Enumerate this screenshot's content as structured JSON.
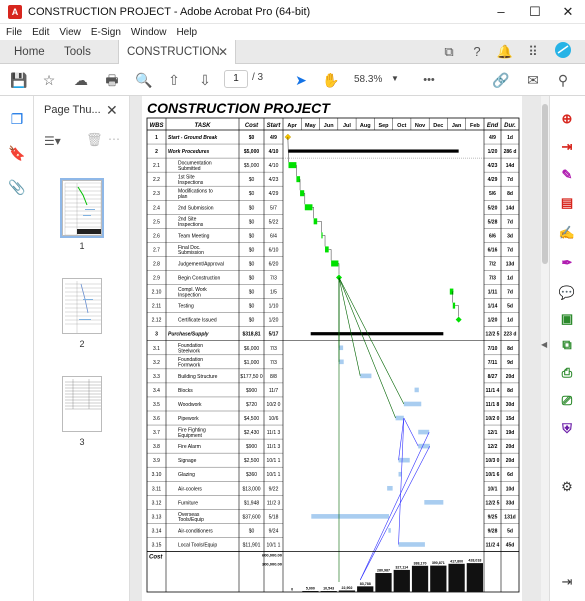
{
  "window": {
    "title": "CONSTRUCTION PROJECT - Adobe Acrobat Pro (64-bit)",
    "minimize": "–",
    "maximize": "☐",
    "close": "✕"
  },
  "menu": [
    "File",
    "Edit",
    "View",
    "E-Sign",
    "Window",
    "Help"
  ],
  "tabs": {
    "home": "Home",
    "tools": "Tools",
    "document": "CONSTRUCTION P...",
    "close": "✕"
  },
  "toolbar": {
    "current_page": "1",
    "page_total": "/ 3",
    "zoom": "58.3%",
    "more": "•••"
  },
  "thumbnails": {
    "title": "Page Thu...",
    "pages": [
      "1",
      "2",
      "3"
    ]
  },
  "document": {
    "title": "CONSTRUCTION PROJECT",
    "columns": [
      "WBS",
      "TASK",
      "Cost",
      "Start"
    ],
    "right_columns": [
      "End",
      "Dur."
    ],
    "months": [
      "Apr",
      "May",
      "Jun",
      "Jul",
      "Aug",
      "Sep",
      "Oct",
      "Nov",
      "Dec",
      "Jan",
      "Feb"
    ],
    "rows": [
      {
        "wbs": "1",
        "task": "Start - Ground Break",
        "cost": "$0",
        "start": "4/9",
        "end": "4/9",
        "dur": "1d",
        "bold": true
      },
      {
        "wbs": "2",
        "task": "Work Procedures",
        "cost": "$5,000",
        "start": "4/10",
        "end": "1/20",
        "dur": "286 d",
        "bold": true
      },
      {
        "wbs": "2.1",
        "task": "Documentation Submitted",
        "cost": "$5,000",
        "start": "4/10",
        "end": "4/23",
        "dur": "14d"
      },
      {
        "wbs": "2.2",
        "task": "1st Site Inspections",
        "cost": "$0",
        "start": "4/23",
        "end": "4/29",
        "dur": "7d"
      },
      {
        "wbs": "2.3",
        "task": "Modifications to plan",
        "cost": "$0",
        "start": "4/29",
        "end": "5/6",
        "dur": "8d"
      },
      {
        "wbs": "2.4",
        "task": "2nd Submission",
        "cost": "$0",
        "start": "5/7",
        "end": "5/20",
        "dur": "14d"
      },
      {
        "wbs": "2.5",
        "task": "2nd Site Inspections",
        "cost": "$0",
        "start": "5/22",
        "end": "5/28",
        "dur": "7d"
      },
      {
        "wbs": "2.6",
        "task": "Team Meeting",
        "cost": "$0",
        "start": "6/4",
        "end": "6/6",
        "dur": "3d"
      },
      {
        "wbs": "2.7",
        "task": "Final Doc. Submission",
        "cost": "$0",
        "start": "6/10",
        "end": "6/16",
        "dur": "7d"
      },
      {
        "wbs": "2.8",
        "task": "Judgement/Approval",
        "cost": "$0",
        "start": "6/20",
        "end": "7/2",
        "dur": "13d"
      },
      {
        "wbs": "2.9",
        "task": "Begin Construction",
        "cost": "$0",
        "start": "7/3",
        "end": "7/3",
        "dur": "1d"
      },
      {
        "wbs": "2.10",
        "task": "Compl. Work Inspection",
        "cost": "$0",
        "start": "1/5",
        "end": "1/11",
        "dur": "7d"
      },
      {
        "wbs": "2.11",
        "task": "Testing",
        "cost": "$0",
        "start": "1/10",
        "end": "1/14",
        "dur": "5d"
      },
      {
        "wbs": "2.12",
        "task": "Certificate Issued",
        "cost": "$0",
        "start": "1/20",
        "end": "1/20",
        "dur": "1d"
      },
      {
        "wbs": "3",
        "task": "Purchase/Supply",
        "cost": "$318,81",
        "start": "5/17",
        "end": "12/2 5",
        "dur": "223 d",
        "bold": true
      },
      {
        "wbs": "3.1",
        "task": "Foundation Steelwork",
        "cost": "$6,000",
        "start": "7/3",
        "end": "7/10",
        "dur": "8d"
      },
      {
        "wbs": "3.2",
        "task": "Foundation Formwork",
        "cost": "$1,000",
        "start": "7/3",
        "end": "7/11",
        "dur": "9d"
      },
      {
        "wbs": "3.3",
        "task": "Building Structure",
        "cost": "$177,50 0",
        "start": "8/8",
        "end": "8/27",
        "dur": "20d"
      },
      {
        "wbs": "3.4",
        "task": "Blocks",
        "cost": "$900",
        "start": "11/7",
        "end": "11/1 4",
        "dur": "8d"
      },
      {
        "wbs": "3.5",
        "task": "Woodwork",
        "cost": "$720",
        "start": "10/2 0",
        "end": "11/1 8",
        "dur": "30d"
      },
      {
        "wbs": "3.6",
        "task": "Pipework",
        "cost": "$4,500",
        "start": "10/6",
        "end": "10/2 0",
        "dur": "15d"
      },
      {
        "wbs": "3.7",
        "task": "Fire Fighting Equipment",
        "cost": "$2,430",
        "start": "11/1 3",
        "end": "12/1",
        "dur": "19d"
      },
      {
        "wbs": "3.8",
        "task": "Fire Alarm",
        "cost": "$900",
        "start": "11/1 3",
        "end": "12/2",
        "dur": "20d"
      },
      {
        "wbs": "3.9",
        "task": "Signage",
        "cost": "$2,500",
        "start": "10/1 1",
        "end": "10/3 0",
        "dur": "20d"
      },
      {
        "wbs": "3.10",
        "task": "Glazing",
        "cost": "$360",
        "start": "10/1 1",
        "end": "10/1 6",
        "dur": "6d"
      },
      {
        "wbs": "3.11",
        "task": "Air-coolers",
        "cost": "$13,000",
        "start": "9/22",
        "end": "10/1",
        "dur": "10d"
      },
      {
        "wbs": "3.12",
        "task": "Furniture",
        "cost": "$1,948",
        "start": "11/2 3",
        "end": "12/2 5",
        "dur": "33d"
      },
      {
        "wbs": "3.13",
        "task": "Overseas Tools/Equip",
        "cost": "$37,600",
        "start": "5/18",
        "end": "9/25",
        "dur": "131d"
      },
      {
        "wbs": "3.14",
        "task": "Air-conditioners",
        "cost": "$0",
        "start": "9/24",
        "end": "9/28",
        "dur": "5d"
      },
      {
        "wbs": "3.15",
        "task": "Local Tools/Equip",
        "cost": "$11,901",
        "start": "10/1 1",
        "end": "11/2 4",
        "dur": "45d"
      }
    ],
    "cost_label": "Cost",
    "cost_axis": [
      "600,000.00",
      "300,000.00"
    ],
    "cost_values": [
      "0",
      "5,000",
      "10,543",
      "22,902",
      "83,788",
      "280,987",
      "327,114",
      "388,170",
      "390,871",
      "417,800",
      "428,018"
    ]
  },
  "colors": {
    "milestone": "#f5c400",
    "work_bar": "#00e000",
    "supply_bar": "#a9cdf0",
    "summary_bar": "#000000",
    "arrow_green": "#006400",
    "arrow_blue": "#3333ff"
  }
}
